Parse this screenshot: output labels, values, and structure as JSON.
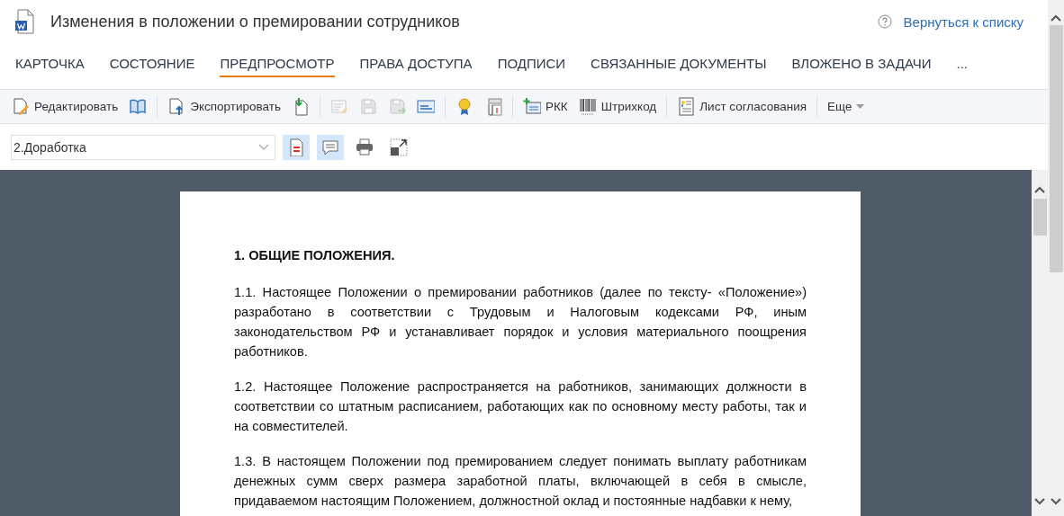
{
  "header": {
    "title": "Изменения в положении о премировании сотрудников",
    "back_link": "Вернуться к списку"
  },
  "tabs": [
    {
      "label": "КАРТОЧКА",
      "selected": false
    },
    {
      "label": "СОСТОЯНИЕ",
      "selected": false
    },
    {
      "label": "ПРЕДПРОСМОТР",
      "selected": true
    },
    {
      "label": "ПРАВА ДОСТУПА",
      "selected": false
    },
    {
      "label": "ПОДПИСИ",
      "selected": false
    },
    {
      "label": "СВЯЗАННЫЕ ДОКУМЕНТЫ",
      "selected": false
    },
    {
      "label": "ВЛОЖЕНО В ЗАДАЧИ",
      "selected": false
    },
    {
      "label": "...",
      "selected": false
    }
  ],
  "toolbar": {
    "groups": [
      [
        {
          "label": "Редактировать",
          "disabled": false
        },
        {
          "disabled": false
        }
      ],
      [
        {
          "label": "Экспортировать",
          "disabled": false
        },
        {
          "disabled": false
        }
      ],
      [
        {
          "disabled": true
        },
        {
          "disabled": true
        },
        {
          "disabled": true
        },
        {
          "disabled": false
        }
      ],
      [
        {
          "disabled": false
        },
        {
          "disabled": false
        }
      ],
      [
        {
          "label": "РКК",
          "disabled": false
        },
        {
          "label": "Штрихкод",
          "disabled": false
        }
      ],
      [
        {
          "label": "Лист согласования",
          "disabled": false
        }
      ],
      [
        {
          "label": "Еще",
          "disabled": false,
          "kind": "dropdown"
        }
      ]
    ]
  },
  "view_bar": {
    "version_select": {
      "value": "2.Доработка"
    },
    "toggles": [
      {
        "on": true
      },
      {
        "on": true
      },
      {
        "on": false
      },
      {
        "on": false
      }
    ]
  },
  "document": {
    "heading": "1. ОБЩИЕ ПОЛОЖЕНИЯ.",
    "paragraphs": [
      "1.1. Настоящее Положении о премировании работников (далее по тексту- «Положение») разработано в соответствии с Трудовым и Налоговым кодексами РФ, иным законодательством РФ и устанавливает порядок и условия материального поощрения работников.",
      "1.2. Настоящее Положение распространяется на работников, занимающих должности в соответствии со штатным расписанием, работающих как по основному месту работы, так и на совместителей.",
      "1.3. В настоящем Положении под премированием следует понимать выплату работникам денежных сумм сверх размера заработной платы, включающей в себя в смысле, придаваемом настоящим Положением, должностной оклад и постоянные надбавки к нему,"
    ]
  }
}
